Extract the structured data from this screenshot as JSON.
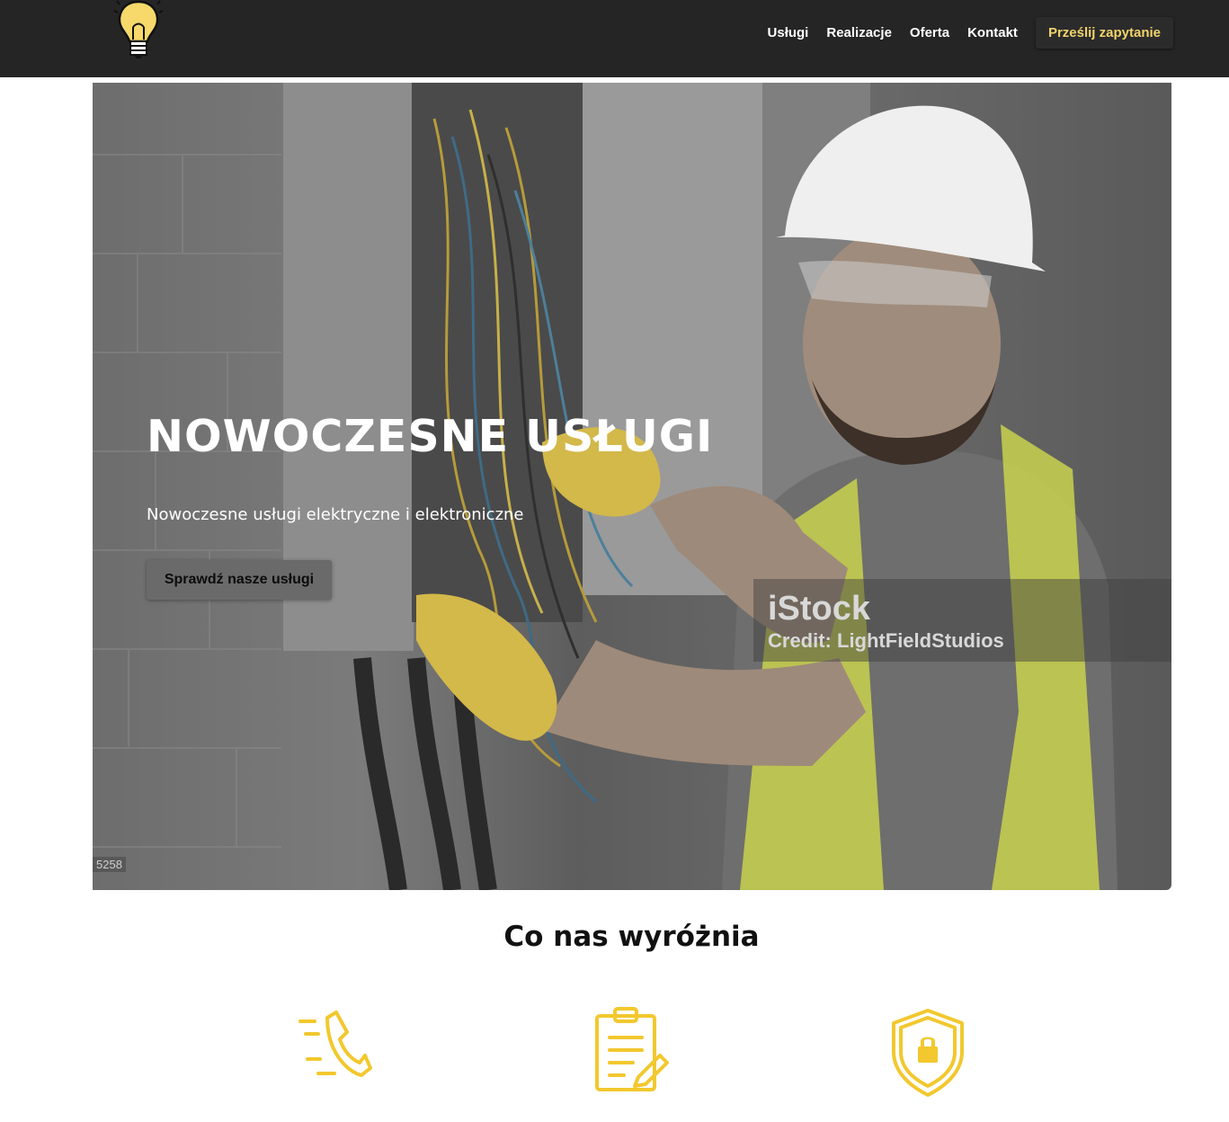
{
  "nav": {
    "logo_icon": "lightbulb-icon",
    "links": [
      "Usługi",
      "Realizacje",
      "Oferta",
      "Kontakt"
    ],
    "cta_label": "Prześlij zapytanie",
    "background": "#252525",
    "cta_color": "#f2d46b"
  },
  "hero": {
    "title": "NOWOCZESNE USŁUGI",
    "subtitle": "Nowoczesne usługi elektryczne i elektroniczne",
    "button_label": "Sprawdź nasze usługi",
    "image_description_icon": "electrician-photo",
    "watermark_brand": "iStock",
    "watermark_credit": "Credit: LightFieldStudios",
    "image_id": "5258"
  },
  "features": {
    "title": "Co nas wyróżnia",
    "accent": "#f2c82e",
    "icons": [
      "phone-icon",
      "clipboard-icon",
      "shield-lock-icon"
    ]
  }
}
